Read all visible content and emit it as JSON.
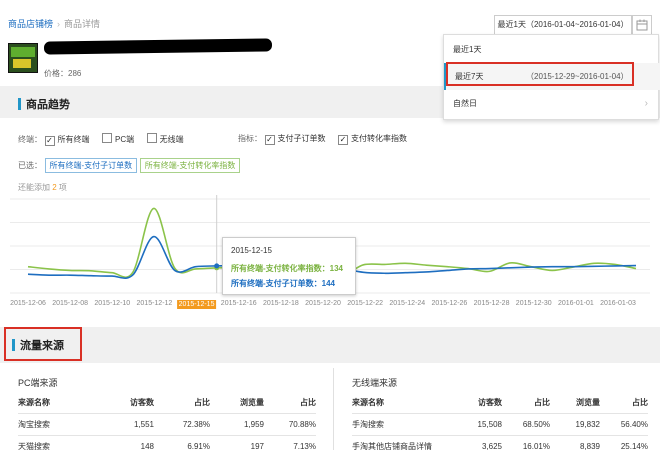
{
  "breadcrumb": {
    "root": "商品店铺榜",
    "current": "商品详情"
  },
  "product": {
    "price_label": "价格：",
    "price": "286"
  },
  "date_picker": {
    "button_label": "最近1天（2016-01-04~2016-01-04）",
    "calendar_icon": "calendar-icon",
    "options": [
      {
        "label": "最近1天",
        "range": ""
      },
      {
        "label": "最近7天",
        "range": "（2015-12-29~2016-01-04）"
      },
      {
        "label": "自然日",
        "range": ""
      }
    ]
  },
  "trend_section": {
    "title": "商品趋势",
    "terminal_label": "终端：",
    "terminal_options": [
      {
        "label": "所有终端",
        "checked": true
      },
      {
        "label": "PC端",
        "checked": false
      },
      {
        "label": "无线端",
        "checked": false
      }
    ],
    "metric_label": "指标：",
    "metric_options": [
      {
        "label": "支付子订单数",
        "checked": true
      },
      {
        "label": "支付转化率指数",
        "checked": true
      }
    ],
    "selected_label": "已选：",
    "selected_tags": [
      "所有终端-支付子订单数",
      "所有终端-支付转化率指数"
    ],
    "hint_pre": "还能添加",
    "hint_num": "2",
    "hint_post": "项"
  },
  "chart_data": {
    "type": "line",
    "x": [
      "2015-12-06",
      "2015-12-07",
      "2015-12-08",
      "2015-12-09",
      "2015-12-10",
      "2015-12-11",
      "2015-12-12",
      "2015-12-13",
      "2015-12-14",
      "2015-12-15",
      "2015-12-16",
      "2015-12-17",
      "2015-12-18",
      "2015-12-19",
      "2015-12-20",
      "2015-12-21",
      "2015-12-22",
      "2015-12-23",
      "2015-12-24",
      "2015-12-25",
      "2015-12-26",
      "2015-12-27",
      "2015-12-28",
      "2015-12-29",
      "2015-12-30",
      "2015-12-31",
      "2016-01-01",
      "2016-01-02",
      "2016-01-03",
      "2016-01-04"
    ],
    "tick_labels": [
      "2015-12-06",
      "2015-12-08",
      "2015-12-10",
      "2015-12-12",
      "2015-12-15",
      "2015-12-16",
      "2015-12-18",
      "2015-12-20",
      "2015-12-22",
      "2015-12-24",
      "2015-12-26",
      "2015-12-28",
      "2015-12-30",
      "2016-01-01",
      "2016-01-03"
    ],
    "highlight_tick": "2015-12-15",
    "series": [
      {
        "name": "所有终端-支付转化率指数",
        "color": "#8bc34a",
        "values": [
          140,
          128,
          120,
          118,
          108,
          110,
          450,
          132,
          128,
          134,
          134,
          142,
          148,
          162,
          160,
          98,
          150,
          152,
          158,
          148,
          140,
          130,
          115,
          160,
          140,
          120,
          138,
          158,
          152,
          130
        ]
      },
      {
        "name": "所有终端-支付子订单数",
        "color": "#1e6ec0",
        "values": [
          100,
          95,
          95,
          92,
          90,
          96,
          300,
          120,
          140,
          144,
          145,
          140,
          135,
          142,
          145,
          130,
          110,
          105,
          108,
          112,
          120,
          128,
          130,
          134,
          138,
          140,
          140,
          142,
          144,
          146
        ]
      }
    ],
    "ylim": [
      0,
      500
    ],
    "grid": true
  },
  "tooltip": {
    "date": "2015-12-15",
    "line1": "所有终端-支付转化率指数：134",
    "line2": "所有终端-支付子订单数：144"
  },
  "traffic_section": {
    "title": "流量来源",
    "pc": {
      "title": "PC端来源",
      "headers": [
        "来源名称",
        "访客数",
        "占比",
        "浏览量",
        "占比"
      ],
      "rows": [
        [
          "淘宝搜索",
          "1,551",
          "72.38%",
          "1,959",
          "70.88%"
        ],
        [
          "天猫搜索",
          "148",
          "6.91%",
          "197",
          "7.13%"
        ]
      ]
    },
    "mobile": {
      "title": "无线端来源",
      "headers": [
        "来源名称",
        "访客数",
        "占比",
        "浏览量",
        "占比"
      ],
      "rows": [
        [
          "手淘搜索",
          "15,508",
          "68.50%",
          "19,832",
          "56.40%"
        ],
        [
          "手淘其他店铺商品详情",
          "3,625",
          "16.01%",
          "8,839",
          "25.14%"
        ]
      ]
    }
  }
}
